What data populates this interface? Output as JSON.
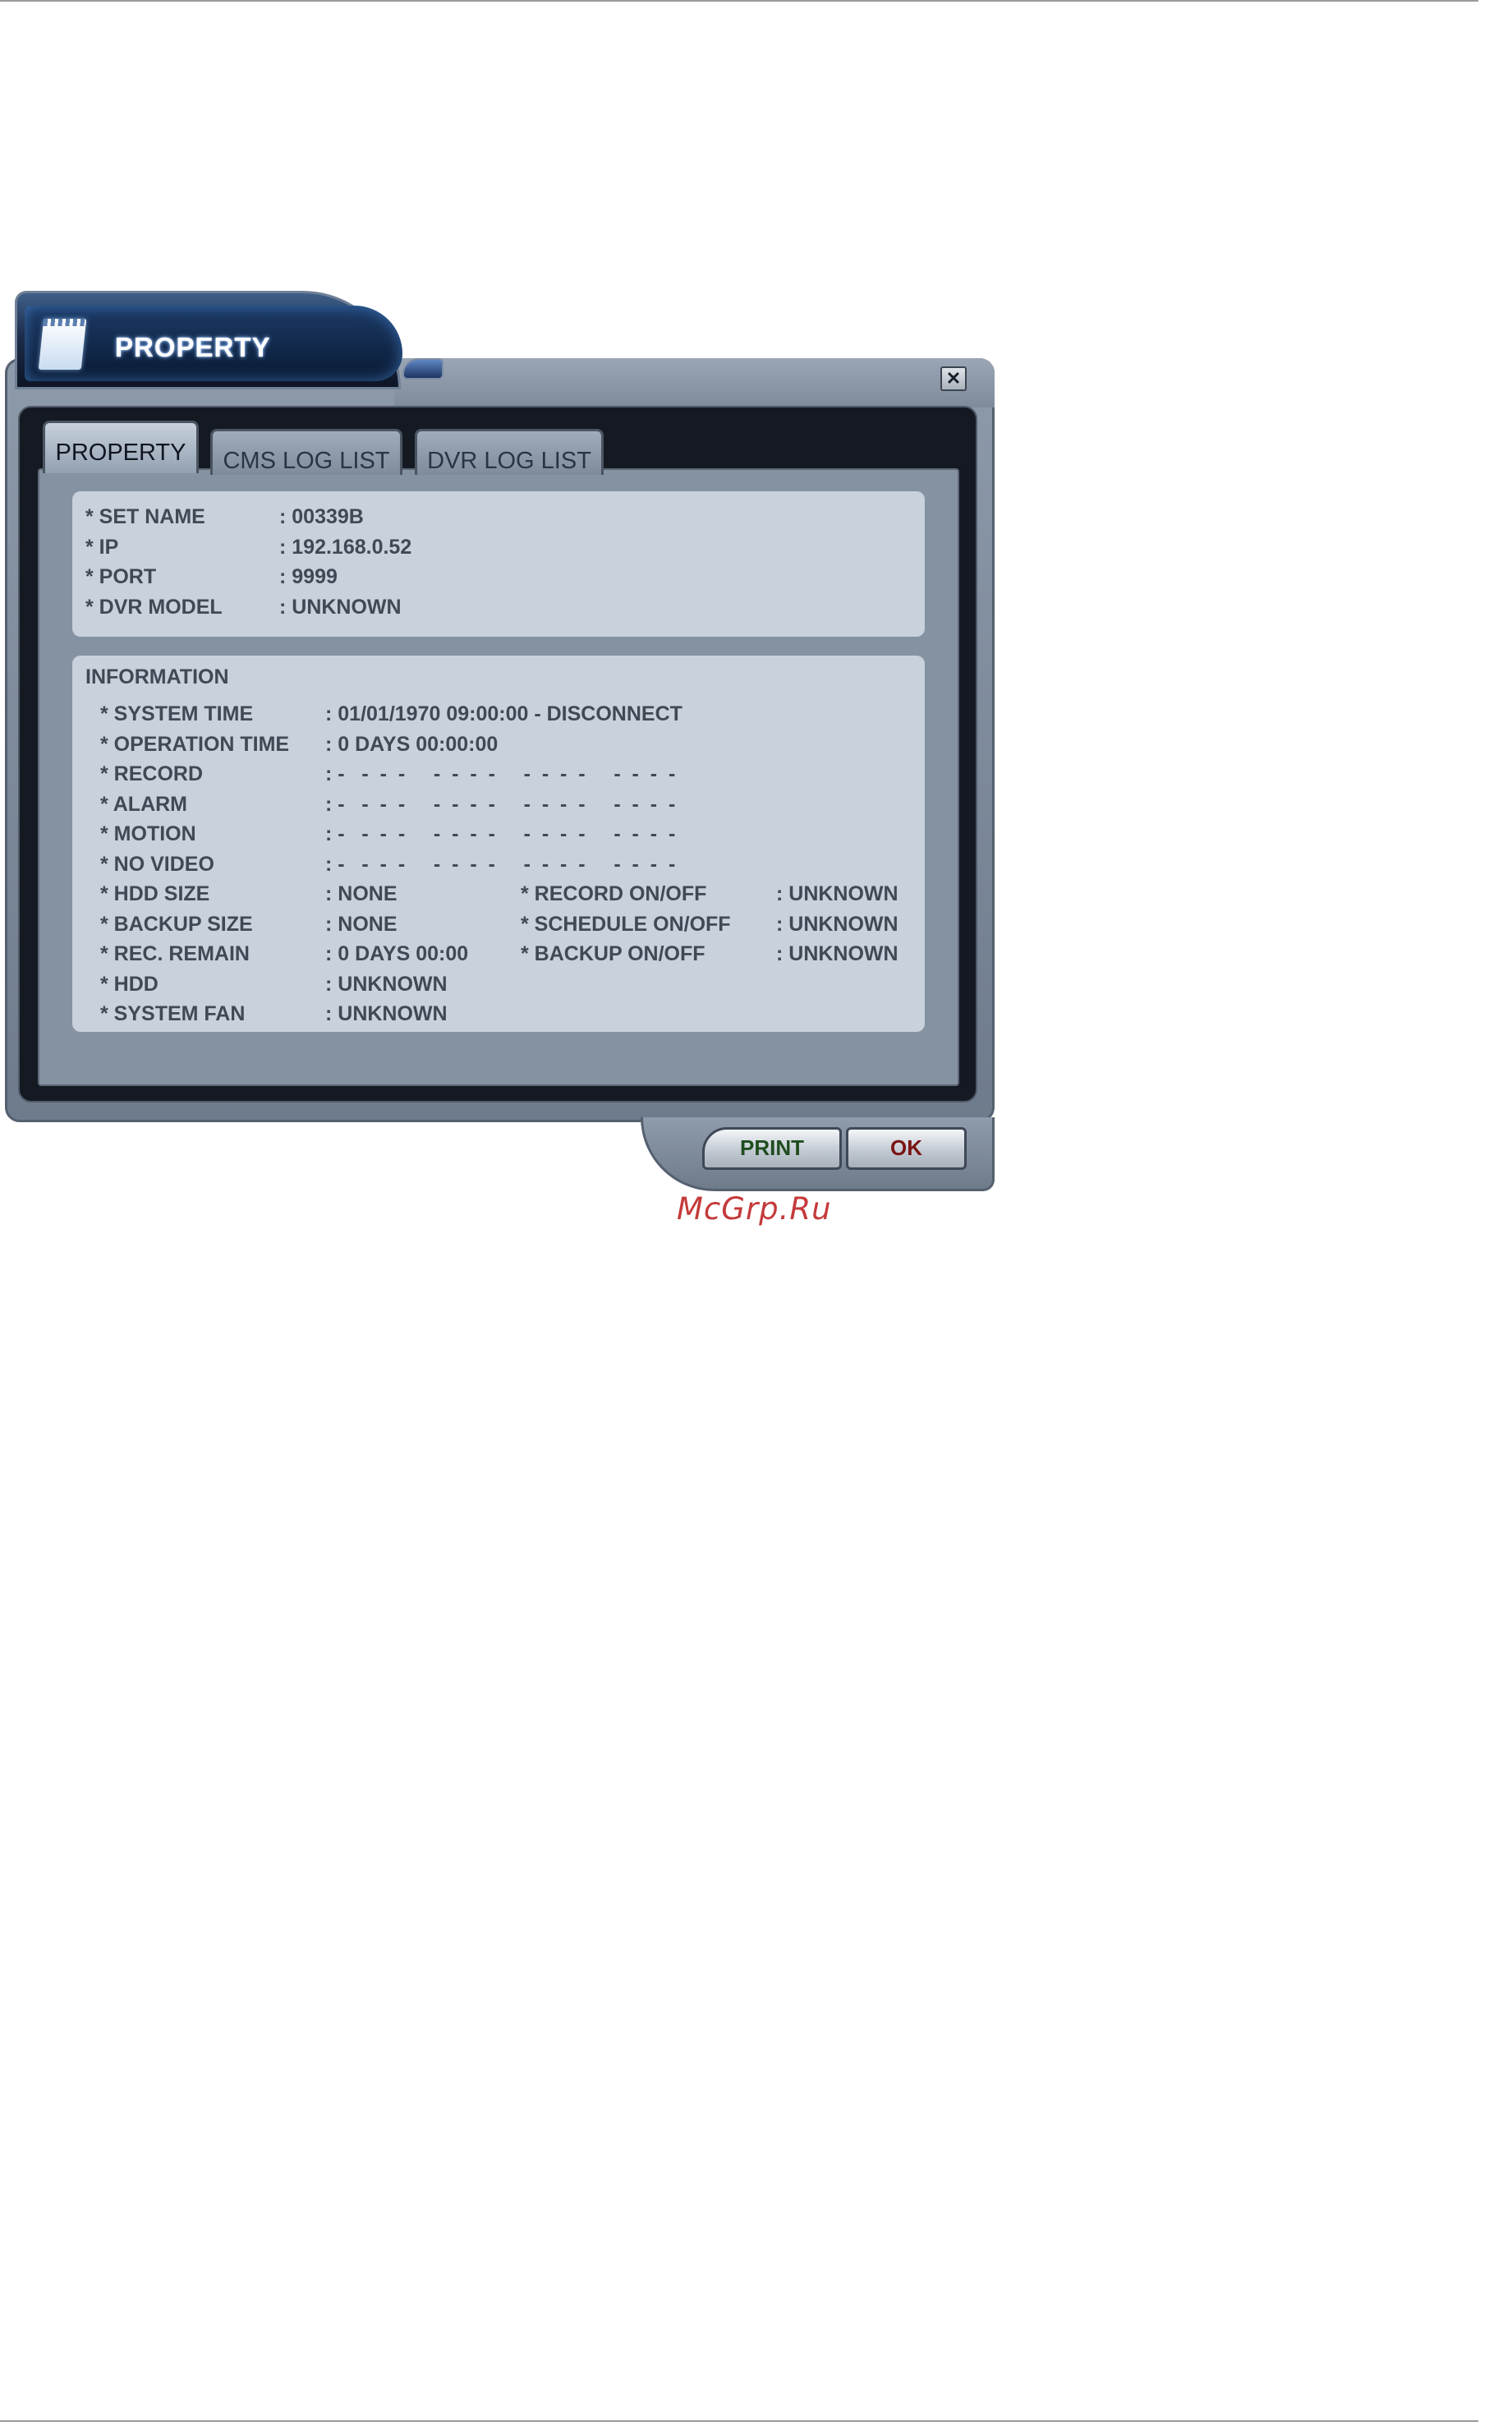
{
  "window": {
    "title": "PROPERTY",
    "close_symbol": "✕"
  },
  "tabs": [
    {
      "label": "PROPERTY",
      "active": true
    },
    {
      "label": "CMS LOG LIST",
      "active": false
    },
    {
      "label": "DVR LOG LIST",
      "active": false
    }
  ],
  "property": [
    {
      "label": "* SET NAME",
      "value": ": 00339B"
    },
    {
      "label": "* IP",
      "value": ": 192.168.0.52"
    },
    {
      "label": "* PORT",
      "value": ": 9999"
    },
    {
      "label": "* DVR MODEL",
      "value": ": UNKNOWN"
    }
  ],
  "information": {
    "heading": "INFORMATION",
    "rows": [
      {
        "label": "* SYSTEM TIME",
        "value": ": 01/01/1970 09:00:00  - DISCONNECT"
      },
      {
        "label": "* OPERATION TIME",
        "value": ": 0 DAYS 00:00:00"
      },
      {
        "label": "* RECORD",
        "value": ": -   -  -  -     -  -  -  -     -  -  -  -     -  -  -  -"
      },
      {
        "label": "* ALARM",
        "value": ": -   -  -  -     -  -  -  -     -  -  -  -     -  -  -  -"
      },
      {
        "label": "* MOTION",
        "value": ": -   -  -  -     -  -  -  -     -  -  -  -     -  -  -  -"
      },
      {
        "label": "* NO VIDEO",
        "value": ": -   -  -  -     -  -  -  -     -  -  -  -     -  -  -  -"
      },
      {
        "label": "* HDD SIZE",
        "value": ": NONE"
      },
      {
        "label": "* BACKUP SIZE",
        "value": ": NONE"
      },
      {
        "label": "* REC. REMAIN",
        "value": ": 0 DAYS 00:00"
      },
      {
        "label": "* HDD",
        "value": ": UNKNOWN"
      },
      {
        "label": "* SYSTEM FAN",
        "value": ": UNKNOWN"
      }
    ],
    "right_rows": [
      {
        "label": "* RECORD ON/OFF",
        "value": ": UNKNOWN"
      },
      {
        "label": "* SCHEDULE ON/OFF",
        "value": ": UNKNOWN"
      },
      {
        "label": "* BACKUP ON/OFF",
        "value": ": UNKNOWN"
      }
    ]
  },
  "buttons": {
    "print": "PRINT",
    "ok": "OK"
  },
  "watermark": "McGrp.Ru"
}
